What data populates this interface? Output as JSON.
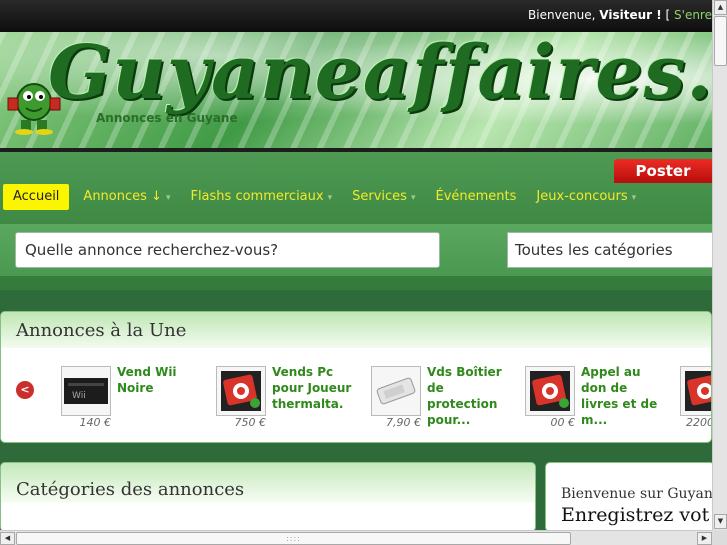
{
  "topbar": {
    "greeting": "Bienvenue, ",
    "user": "Visiteur !",
    "bracket": " [ ",
    "signin_link": "S'enre"
  },
  "header": {
    "logo_text": "Guyaneaffaires.co",
    "tagline": "Annonces en Guyane"
  },
  "poster_button": "Poster",
  "menu": [
    {
      "label": "Accueil",
      "caret": ""
    },
    {
      "label": "Annonces ↓",
      "caret": "▾"
    },
    {
      "label": "Flashs commerciaux",
      "caret": "▾"
    },
    {
      "label": "Services",
      "caret": "▾"
    },
    {
      "label": "Événements",
      "caret": ""
    },
    {
      "label": "Jeux-concours",
      "caret": "▾"
    }
  ],
  "search": {
    "placeholder": "Quelle annonce recherchez-vous?",
    "category_selected": "Toutes les catégories"
  },
  "featured": {
    "title": "Annonces à la Une",
    "prev_icon": "<",
    "ads": [
      {
        "title": "Vend Wii Noire",
        "price": "140 €",
        "icon": "wii-console-icon"
      },
      {
        "title": "Vends Pc pour Joueur thermalta.",
        "price": "750 €",
        "icon": "photo-placeholder-icon"
      },
      {
        "title": "Vds Boîtier de protection pour...",
        "price": "7,90 €",
        "icon": "case-icon"
      },
      {
        "title": "Appel au don de livres et de m...",
        "price": "00 €",
        "icon": "photo-placeholder-icon"
      },
      {
        "title": "",
        "price": "2200",
        "icon": "photo-placeholder-icon"
      }
    ]
  },
  "categories": {
    "title": "Catégories des annonces"
  },
  "welcome_panel": {
    "line1": "Bienvenue sur Guyan",
    "line2": "Enregistrez vot"
  },
  "scrollbar_glyphs": {
    "up": "▲",
    "down": "▼",
    "left": "◀",
    "right": "▶",
    "grip": "::::"
  },
  "colors": {
    "menu_text": "#f2ea2b",
    "menu_active_bg": "#fbf500",
    "poster_red": "#d61d18",
    "ad_title_green": "#2f8a1b"
  }
}
